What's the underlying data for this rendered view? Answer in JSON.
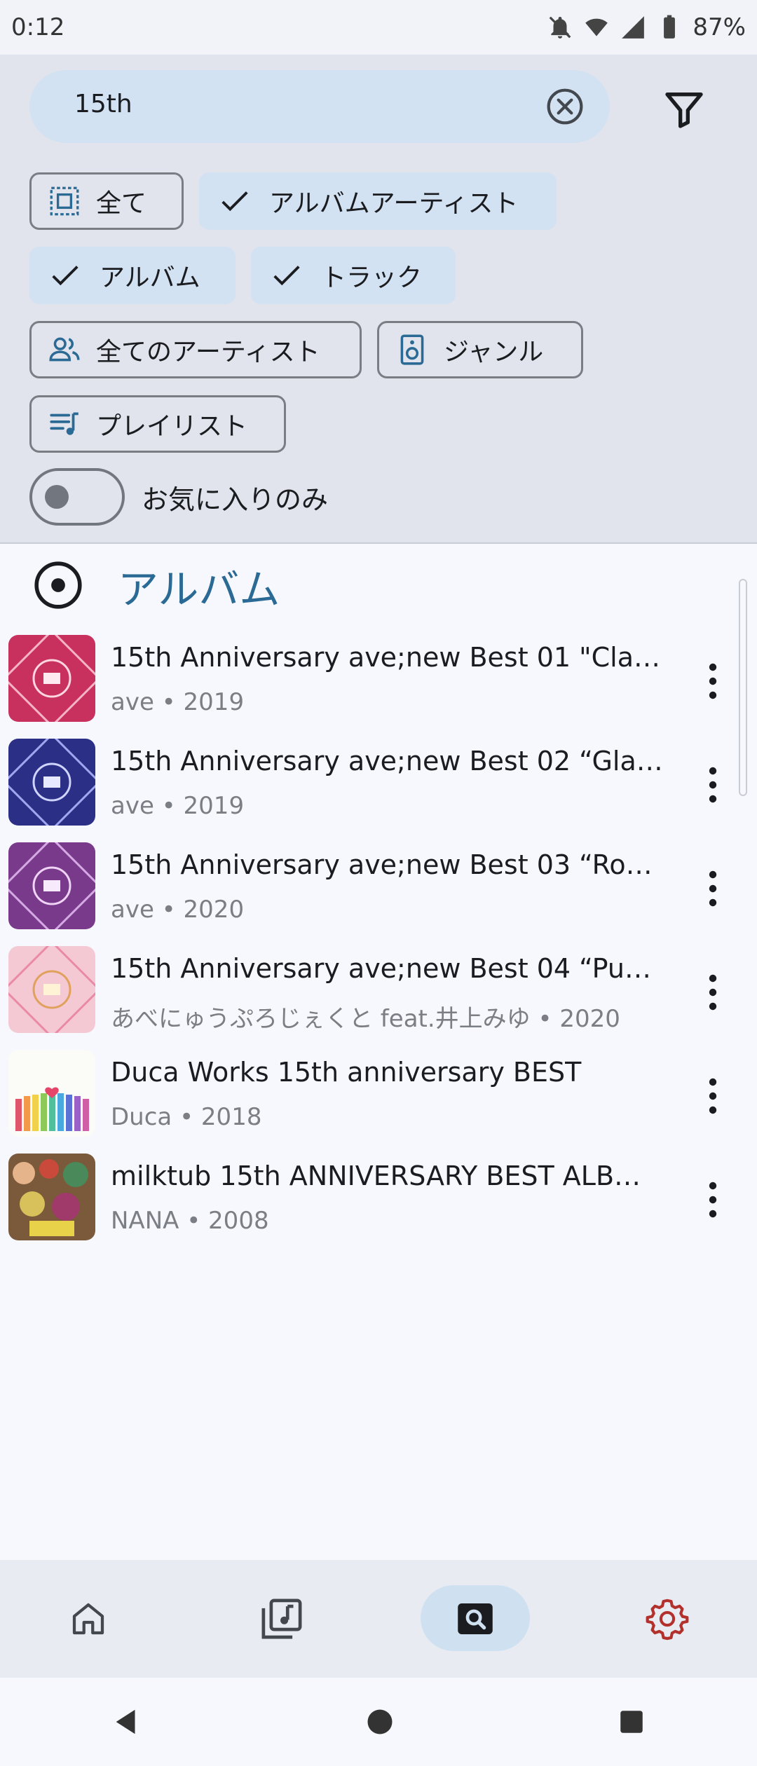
{
  "status_bar": {
    "time": "0:12",
    "battery": "87%"
  },
  "search": {
    "query": "15th"
  },
  "filters": {
    "all": "全て",
    "album_artist": "アルバムアーティスト",
    "album": "アルバム",
    "track": "トラック",
    "all_artists": "全てのアーティスト",
    "genre": "ジャンル",
    "playlist": "プレイリスト"
  },
  "favorites_only": {
    "label": "お気に入りのみ",
    "on": false
  },
  "section": {
    "title": "アルバム"
  },
  "albums": [
    {
      "title": "15th Anniversary ave;new Best 01 \"Cla…",
      "subtitle": "ave • 2019"
    },
    {
      "title": "15th Anniversary ave;new Best 02 “Gla…",
      "subtitle": "ave • 2019"
    },
    {
      "title": "15th Anniversary ave;new Best 03 “Ro…",
      "subtitle": "ave • 2020"
    },
    {
      "title": "15th Anniversary ave;new Best 04 “Pu…",
      "subtitle": "あべにゅうぷろじぇくと feat.井上みゆ • 2020"
    },
    {
      "title": "Duca Works 15th anniversary BEST",
      "subtitle": "Duca • 2018"
    },
    {
      "title": "milktub 15th ANNIVERSARY BEST ALB…",
      "subtitle": "NANA • 2008"
    }
  ],
  "colors": {
    "accent": "#2a6a94",
    "chip_selected": "#d2e2f2",
    "settings_icon": "#b3312c"
  }
}
